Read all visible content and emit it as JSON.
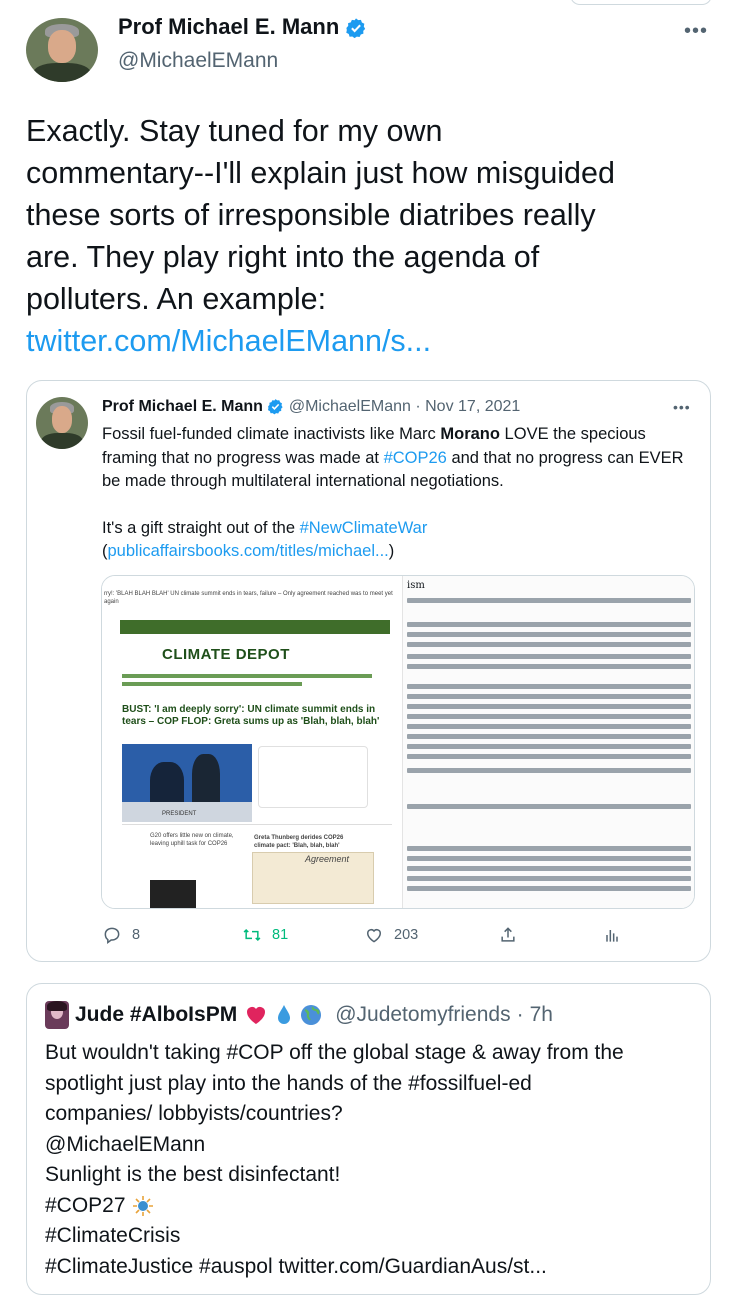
{
  "tweet": {
    "author_name": "Prof Michael E. Mann",
    "author_handle": "@MichaelEMann",
    "more_label": "•••",
    "text_lines": [
      "Exactly. Stay tuned for my own",
      "commentary--I'll explain just how misguided",
      "these sorts of irresponsible diatribes really",
      "are. They play right into the agenda of",
      "polluters. An example:"
    ],
    "link_text": "twitter.com/MichaelEMann/s..."
  },
  "quoted": {
    "author_name": "Prof Michael E. Mann",
    "author_handle": "@MichaelEMann",
    "separator": " · ",
    "date": "Nov 17, 2021",
    "more_label": "•••",
    "para1": {
      "part1": "Fossil fuel-funded climate inactivists like Marc ",
      "bold": "Morano",
      "part2": " LOVE the specious framing that no progress was made at ",
      "hashtag": "#COP26",
      "part3": " and that no progress can EVER be made through multilateral international negotiations."
    },
    "para2": {
      "part1": "It's a gift straight out of the ",
      "hashtag": "#NewClimateWar",
      "part2": " (",
      "link": "publicaffairsbooks.com/titles/michael...",
      "part3": ")"
    },
    "media": {
      "left_top_caption": "rry!: 'BLAH BLAH BLAH' UN climate summit ends in tears, failure – Only agreement reached was to meet yet again",
      "site_logo": "CLIMATE DEPOT",
      "headline": "BUST: 'I am deeply sorry': UN climate summit ends in tears – COP FLOP: Greta sums up as 'Blah, blah, blah'",
      "photo_caption": "PRESIDENT",
      "sub1": "G20 offers little new on climate, leaving uphill task for COP26",
      "sub2": "Greta Thunberg derides COP26 climate pact: 'Blah, blah, blah'",
      "agreement_label": "Agreement",
      "right_title": "ism"
    },
    "actions": {
      "reply_count": "8",
      "retweet_count": "81",
      "like_count": "203"
    }
  },
  "reply": {
    "author_name": "Jude #AlboIsPM",
    "author_handle": "@Judetomyfriends",
    "separator": " · ",
    "time": "7h",
    "lines": [
      "But wouldn't taking #COP off the global stage & away from the",
      "spotlight just play into the hands of the #fossilfuel-ed",
      "companies/ lobbyists/countries?",
      "@MichaelEMann",
      "Sunlight is the best disinfectant!",
      "#COP27",
      "#ClimateCrisis",
      "#ClimateJustice #auspol twitter.com/GuardianAus/st..."
    ]
  },
  "colors": {
    "link": "#1d9bf0",
    "secondary_text": "#536471",
    "border": "#cfd9de",
    "retweet_green": "#00ba7c",
    "heart_red": "#e0245e",
    "climate_depot_green": "#3f6d2a"
  }
}
